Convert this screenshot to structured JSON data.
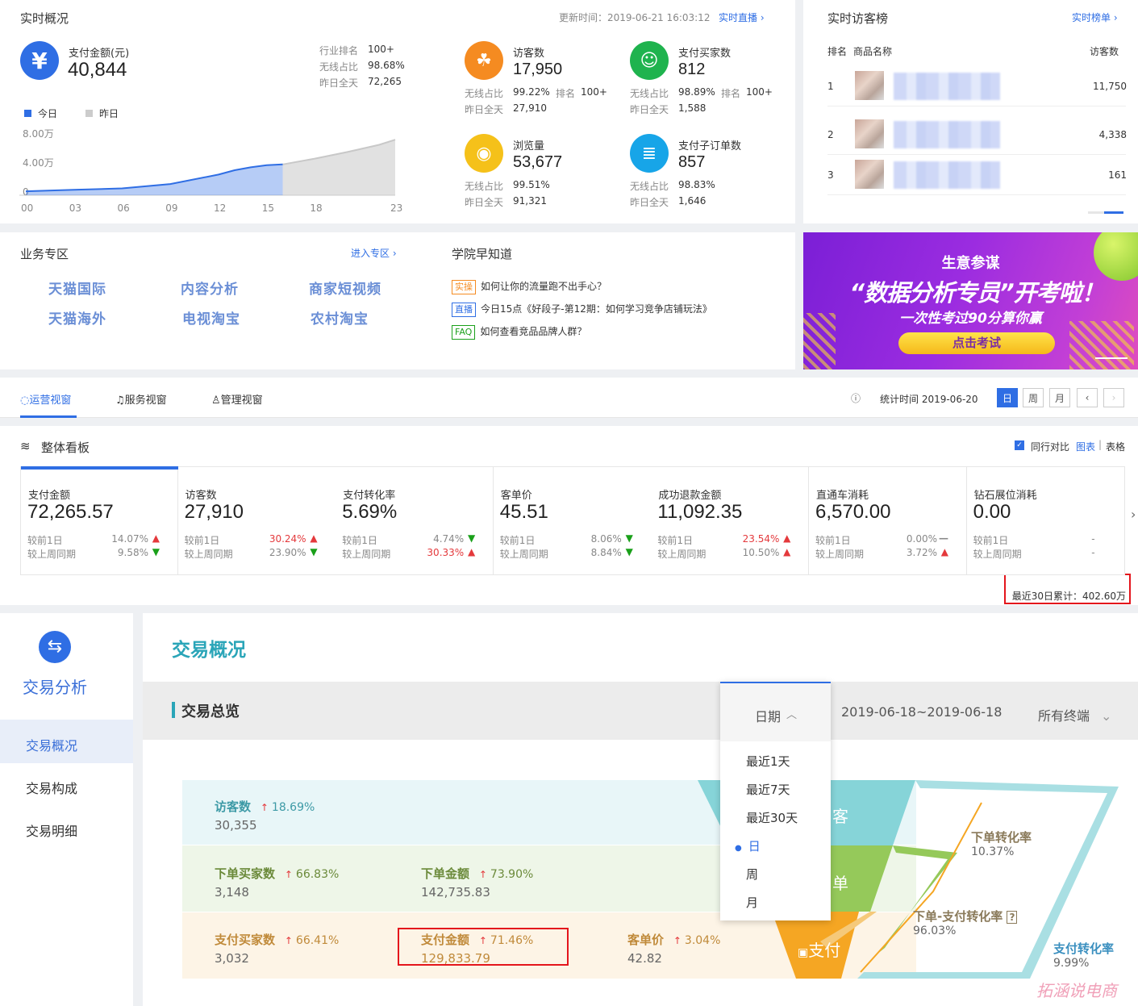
{
  "realtime": {
    "title": "实时概况",
    "update_time": "更新时间：2019-06-21 16:03:12",
    "live_link": "实时直播",
    "pay_amount_label": "支付金额(元)",
    "pay_amount_value": "40,844",
    "rank_label": "行业排名",
    "rank_value": "100+",
    "wireless_label": "无线占比",
    "wireless_value": "98.68%",
    "yesterday_label": "昨日全天",
    "yesterday_value": "72,265",
    "legend_today": "今日",
    "legend_yesterday": "昨日",
    "y_ticks": [
      "8.00万",
      "4.00万",
      "0"
    ],
    "x_ticks": [
      "00",
      "03",
      "06",
      "09",
      "12",
      "15",
      "18",
      "23"
    ],
    "kpis": [
      {
        "label": "访客数",
        "value": "17,950",
        "r1l": "无线占比",
        "r1v": "99.22%",
        "r1l2": "排名",
        "r1v2": "100+",
        "r2l": "昨日全天",
        "r2v": "27,910",
        "color": "#f58b21",
        "icon": "footprint-icon"
      },
      {
        "label": "支付买家数",
        "value": "812",
        "r1l": "无线占比",
        "r1v": "98.89%",
        "r1l2": "排名",
        "r1v2": "100+",
        "r2l": "昨日全天",
        "r2v": "1,588",
        "color": "#1fb34e",
        "icon": "buyers-icon"
      },
      {
        "label": "浏览量",
        "value": "53,677",
        "r1l": "无线占比",
        "r1v": "99.51%",
        "r1l2": "",
        "r1v2": "",
        "r2l": "昨日全天",
        "r2v": "91,321",
        "color": "#f5c11a",
        "icon": "eye-icon"
      },
      {
        "label": "支付子订单数",
        "value": "857",
        "r1l": "无线占比",
        "r1v": "98.83%",
        "r1l2": "",
        "r1v2": "",
        "r2l": "昨日全天",
        "r2v": "1,646",
        "color": "#17a5e8",
        "icon": "order-icon"
      }
    ],
    "chart_data": {
      "type": "area",
      "x": [
        "00",
        "03",
        "06",
        "09",
        "12",
        "15",
        "18",
        "23"
      ],
      "ylim": [
        0,
        8
      ],
      "yunit": "万",
      "series": [
        {
          "name": "今日",
          "x": [
            0,
            3,
            6,
            9,
            12,
            13,
            14,
            15,
            16
          ],
          "values": [
            0.1,
            0.3,
            0.5,
            1.1,
            2.4,
            3.0,
            3.4,
            3.7,
            3.8
          ]
        },
        {
          "name": "昨日",
          "x": [
            16,
            18,
            20,
            22,
            23
          ],
          "values": [
            3.8,
            4.6,
            5.5,
            6.5,
            7.2
          ]
        }
      ]
    }
  },
  "visitors": {
    "title": "实时访客榜",
    "link": "实时榜单",
    "col_rank": "排名",
    "col_name": "商品名称",
    "col_count": "访客数",
    "rows": [
      {
        "rank": "1",
        "count": "11,750"
      },
      {
        "rank": "2",
        "count": "4,338"
      },
      {
        "rank": "3",
        "count": "161"
      }
    ]
  },
  "biz": {
    "title": "业务专区",
    "link": "进入专区",
    "items": [
      "天猫国际",
      "内容分析",
      "商家短视频",
      "天猫海外",
      "电视淘宝",
      "农村淘宝"
    ]
  },
  "academy": {
    "title": "学院早知道",
    "items": [
      {
        "tag": "实操",
        "text": "如何让你的流量跑不出手心？"
      },
      {
        "tag": "直播",
        "text": "今日15点《好段子-第12期：如何学习竞争店铺玩法》"
      },
      {
        "tag": "FAQ",
        "text": "如何查看竞品品牌人群？"
      }
    ]
  },
  "banner": {
    "top": "生意参谋",
    "main": "“数据分析专员”开考啦！",
    "sub": "一次性考过90分算你赢",
    "btn": "点击考试"
  },
  "viewtabs": {
    "tabs": [
      "运营视窗",
      "服务视窗",
      "管理视窗"
    ],
    "stat_time": "统计时间 2019-06-20",
    "period": [
      "日",
      "周",
      "月"
    ],
    "prev": "‹",
    "next": "›"
  },
  "board": {
    "title": "整体看板",
    "compare": "同行对比",
    "chart": "图表",
    "table": "表格",
    "cumulative": "最近30日累计：402.60万",
    "cards": [
      {
        "t": "支付金额",
        "v": "72,265.57",
        "l1": "较前1日",
        "p1": "14.07%",
        "d1": "up",
        "l2": "较上周同期",
        "p2": "9.58%",
        "d2": "down"
      },
      {
        "t": "访客数",
        "v": "27,910",
        "l1": "较前1日",
        "p1": "30.24%",
        "d1": "up",
        "l2": "较上周同期",
        "p2": "23.90%",
        "d2": "down"
      },
      {
        "t": "支付转化率",
        "v": "5.69%",
        "l1": "较前1日",
        "p1": "4.74%",
        "d1": "down",
        "l2": "较上周同期",
        "p2": "30.33%",
        "d2": "up"
      },
      {
        "t": "客单价",
        "v": "45.51",
        "l1": "较前1日",
        "p1": "8.06%",
        "d1": "down",
        "l2": "较上周同期",
        "p2": "8.84%",
        "d2": "down"
      },
      {
        "t": "成功退款金额",
        "v": "11,092.35",
        "l1": "较前1日",
        "p1": "23.54%",
        "d1": "up",
        "l2": "较上周同期",
        "p2": "10.50%",
        "d2": "up"
      },
      {
        "t": "直通车消耗",
        "v": "6,570.00",
        "l1": "较前1日",
        "p1": "0.00%",
        "d1": "flat",
        "l2": "较上周同期",
        "p2": "3.72%",
        "d2": "up"
      },
      {
        "t": "钻石展位消耗",
        "v": "0.00",
        "l1": "较前1日",
        "p1": "-",
        "d1": "none",
        "l2": "较上周同期",
        "p2": "-",
        "d2": "none"
      }
    ]
  },
  "trade": {
    "side_title": "交易分析",
    "menu": [
      "交易概况",
      "交易构成",
      "交易明细"
    ],
    "page_title": "交易概况",
    "overview": "交易总览",
    "date_label": "日期",
    "date_range": "2019-06-18~2019-06-18",
    "terminal": "所有终端",
    "date_options": [
      "最近1天",
      "最近7天",
      "最近30天",
      "日",
      "周",
      "月"
    ],
    "visitors_label": "访客数",
    "visitors_pct": "18.69%",
    "visitors_val": "30,355",
    "order_buyers_label": "下单买家数",
    "order_buyers_pct": "66.83%",
    "order_buyers_val": "3,148",
    "order_amount_label": "下单金额",
    "order_amount_pct": "73.90%",
    "order_amount_val": "142,735.83",
    "pay_buyers_label": "支付买家数",
    "pay_buyers_pct": "66.41%",
    "pay_buyers_val": "3,032",
    "pay_amount_label": "支付金额",
    "pay_amount_pct": "71.46%",
    "pay_amount_val": "129,833.79",
    "unit_price_label": "客单价",
    "unit_price_pct": "3.04%",
    "unit_price_val": "42.82",
    "funnel": [
      "客",
      "单",
      "支付"
    ],
    "rate1_label": "下单转化率",
    "rate1_val": "10.37%",
    "rate2_label": "下单-支付转化率",
    "rate2_val": "96.03%",
    "rate3_label": "支付转化率",
    "rate3_val": "9.99%",
    "watermark": "拓涵说电商"
  }
}
